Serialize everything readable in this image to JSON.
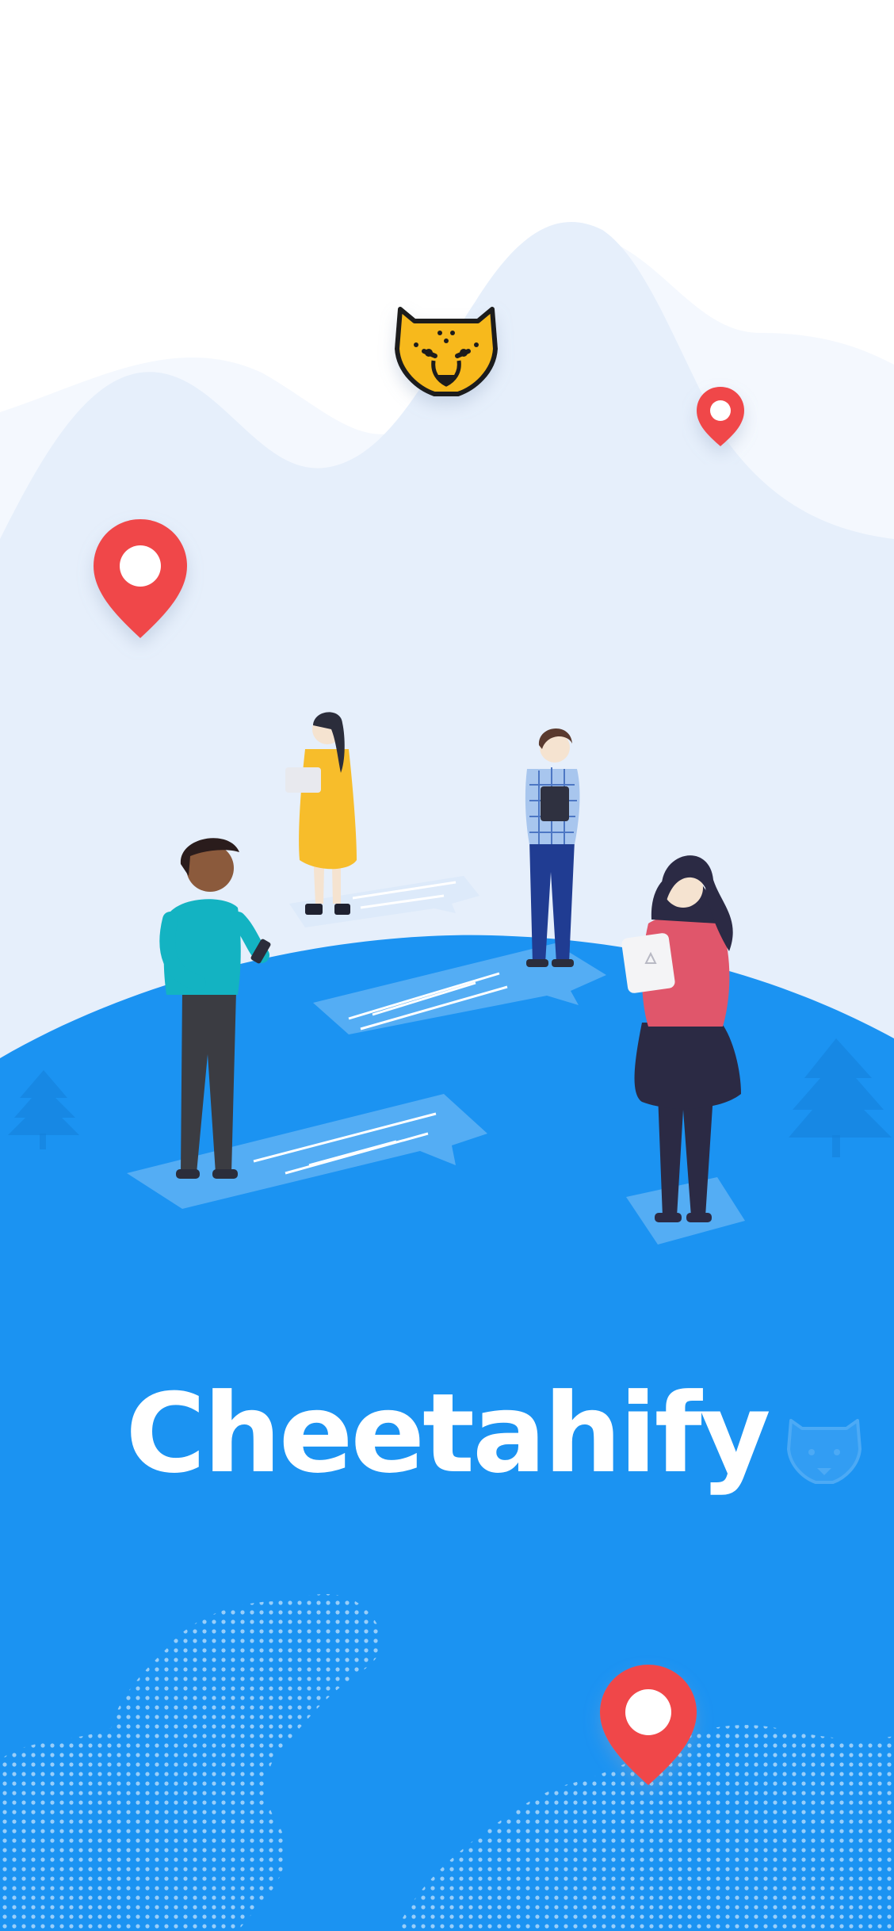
{
  "app": {
    "name": "Cheetahify"
  },
  "colors": {
    "sky": "#ffffff",
    "hill_back": "#f4f8fe",
    "hill_front": "#e6effb",
    "globe": "#1b93f2",
    "pin": "#f0474a",
    "logo": "#f7b91b"
  },
  "icons": {
    "logo": "cheetah-logo-icon",
    "watermark": "cheetah-watermark-icon",
    "pin": "map-pin-icon"
  }
}
